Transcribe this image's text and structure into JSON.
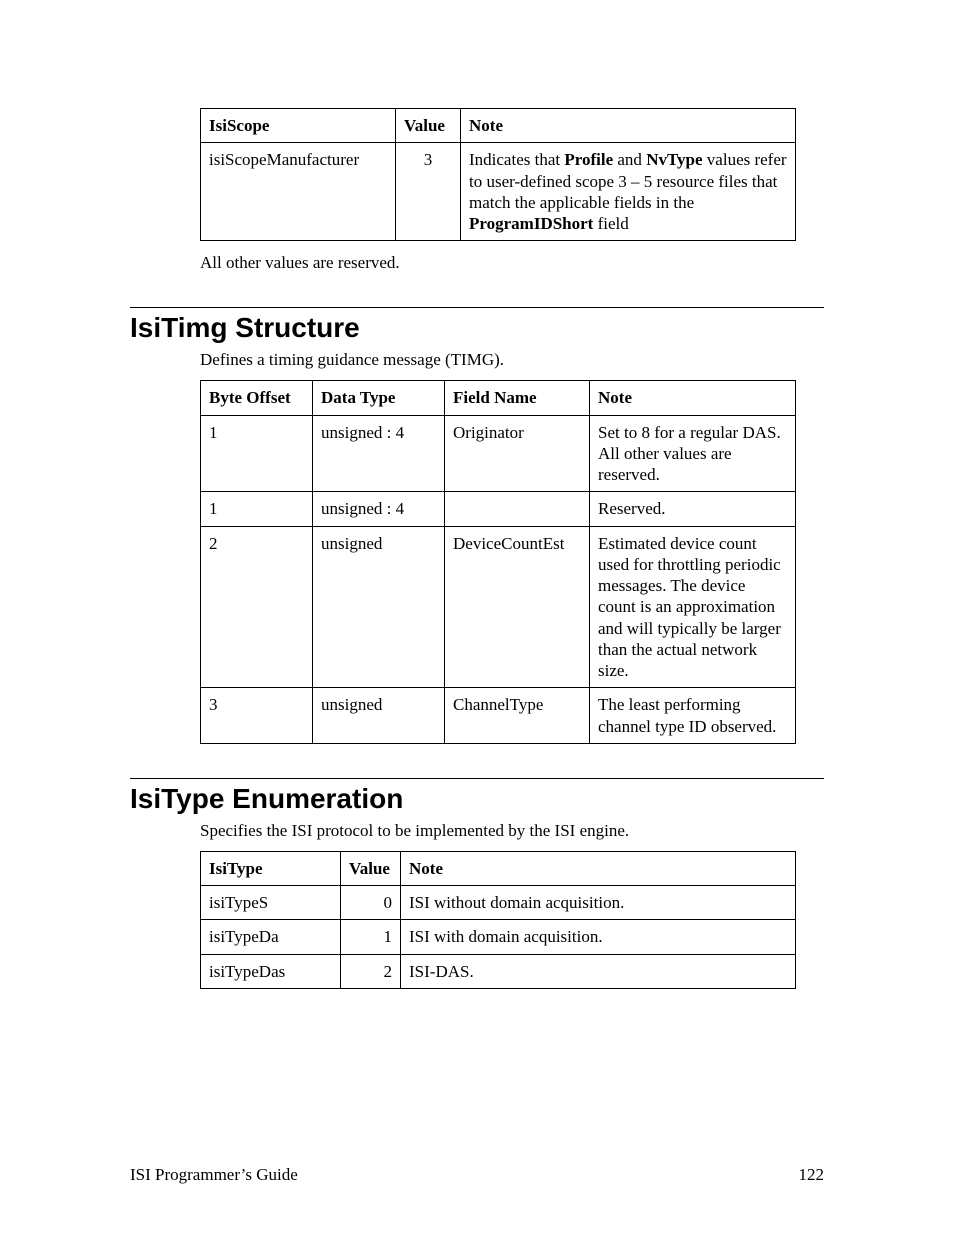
{
  "table1": {
    "headers": [
      "IsiScope",
      "Value",
      "Note"
    ],
    "row": {
      "name": "isiScopeManufacturer",
      "value": "3",
      "note_pre": "Indicates that ",
      "note_b1": "Profile",
      "note_mid1": " and ",
      "note_b2": "NvType",
      "note_mid2": " values refer to user-defined scope 3 – 5 resource files that match the applicable fields in the ",
      "note_b3": "ProgramIDShort",
      "note_post": " field"
    }
  },
  "para_reserved": "All other values are reserved.",
  "section2": {
    "title": "IsiTimg Structure",
    "desc": "Defines a timing guidance message (TIMG).",
    "headers": [
      "Byte Offset",
      "Data Type",
      "Field Name",
      "Note"
    ],
    "rows": [
      {
        "offset": "1",
        "dtype": "unsigned : 4",
        "field": "Originator",
        "note": "Set to 8 for a regular DAS.  All other values are reserved."
      },
      {
        "offset": "1",
        "dtype": "unsigned : 4",
        "field": "",
        "note": "Reserved."
      },
      {
        "offset": "2",
        "dtype": "unsigned",
        "field": "DeviceCountEst",
        "note": "Estimated device count used for throttling periodic messages.  The device count is an approximation and will typically be larger than the actual network size."
      },
      {
        "offset": "3",
        "dtype": "unsigned",
        "field": "ChannelType",
        "note": "The least performing channel type ID observed."
      }
    ]
  },
  "section3": {
    "title": "IsiType Enumeration",
    "desc": "Specifies the ISI protocol to be implemented by the ISI engine.",
    "headers": [
      "IsiType",
      "Value",
      "Note"
    ],
    "rows": [
      {
        "name": "isiTypeS",
        "value": "0",
        "note": "ISI without domain acquisition."
      },
      {
        "name": "isiTypeDa",
        "value": "1",
        "note": "ISI with domain acquisition."
      },
      {
        "name": "isiTypeDas",
        "value": "2",
        "note": "ISI-DAS."
      }
    ]
  },
  "footer": {
    "left": "ISI Programmer’s Guide",
    "page": "122"
  }
}
